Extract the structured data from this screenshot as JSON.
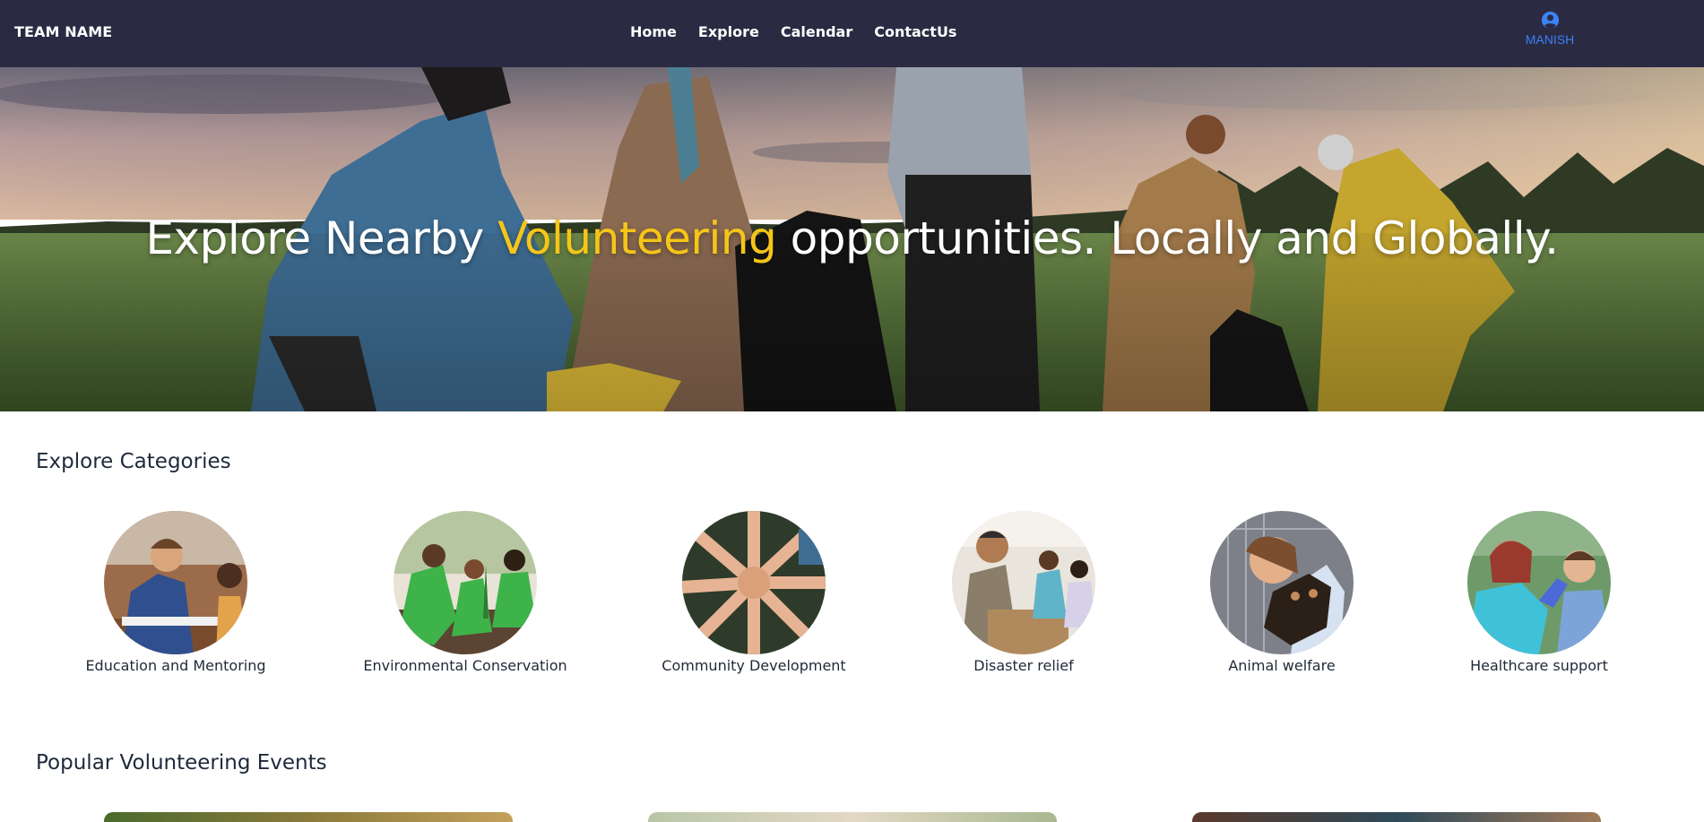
{
  "navbar": {
    "brand": "TEAM NAME",
    "links": [
      "Home",
      "Explore",
      "Calendar",
      "ContactUs"
    ],
    "user": {
      "icon": "user-circle-icon",
      "name": "MANISH"
    },
    "colors": {
      "background": "#2b2a43",
      "user_accent": "#3b82f6"
    }
  },
  "hero": {
    "title_before": "Explore Nearby ",
    "title_accent": "Volunteering",
    "title_after": " opportunities. Locally and Globally.",
    "accent_color": "#f5c518",
    "image": "volunteers-cleaning-field-photo"
  },
  "categories": {
    "title": "Explore Categories",
    "items": [
      {
        "label": "Education and Mentoring",
        "image": "education-photo"
      },
      {
        "label": "Environmental Conservation",
        "image": "planting-photo"
      },
      {
        "label": "Community Development",
        "image": "hands-together-photo"
      },
      {
        "label": "Disaster relief",
        "image": "food-distribution-photo"
      },
      {
        "label": "Animal welfare",
        "image": "dog-shelter-photo"
      },
      {
        "label": "Healthcare support",
        "image": "healthcare-photo"
      }
    ]
  },
  "popular": {
    "title": "Popular Volunteering Events",
    "cards": [
      "event-card-1-photo",
      "event-card-2-photo",
      "event-card-3-photo"
    ]
  }
}
